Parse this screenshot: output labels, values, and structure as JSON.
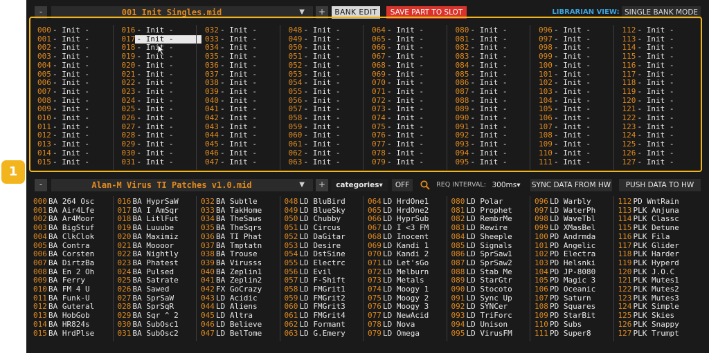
{
  "top": {
    "minus": "-",
    "file": "001 Init Singles.mid",
    "plus": "+",
    "bank_edit": "BANK EDIT",
    "save_part": "SAVE PART TO SLOT",
    "librarian_label": "LIBRARIAN VIEW:",
    "mode": "SINGLE BANK MODE"
  },
  "bottom": {
    "minus": "-",
    "file": "Alan-M Virus TI Patches v1.0.mid",
    "plus": "+",
    "categories": "categories",
    "off": "OFF",
    "req_label": "REQ INTERVAL:",
    "req_value": "300ms",
    "sync": "SYNC DATA FROM HW",
    "push": "PUSH DATA TO HW"
  },
  "bank_name": "- Init -",
  "selected_slot": "017",
  "annotation_badge": "1",
  "colors": {
    "accent": "#e08a1e",
    "highlight": "#f2b51e",
    "save": "#d9342b",
    "librarian": "#3fa3d9"
  },
  "lib_patches": [
    "BA 264 Osc",
    "BA Air4Lfe",
    "BA Ar4Moor",
    "BA BigStuf",
    "BA ClkClok",
    "BA Contra",
    "BA Corsten",
    "BA DirtzBa",
    "BA En 2 Oh",
    "BA Ferry",
    "BA FM 4 U",
    "BA Funk-U",
    "BA Guteral",
    "BA HobGob",
    "BA HR824s",
    "BA HrdPlse",
    "BA HyprSaW",
    "BA I AmSqr",
    "BA LitlFut",
    "BA Luuube",
    "BA Maximiz",
    "BA Moooor",
    "BA Nightly",
    "BA Phatest",
    "BA Pulsed",
    "BA Satrate",
    "BA Sawed",
    "BA SprSaW",
    "BA SprSqR",
    "BA Sqr ^ 2",
    "BA SubOsc1",
    "BA SubOsc2",
    "BA Subtle",
    "BA TakHome",
    "BA TheSaws",
    "BA TheSqrs",
    "BA TI Phat",
    "BA Tmptatn",
    "BA Trouse",
    "BA Virusss",
    "BA Zeplin1",
    "BA Zeplin2",
    "FX GoCrazy",
    "LD Acidic",
    "LD Aliens",
    "LD Altra",
    "LD Believe",
    "LD BelTome",
    "LD BluBird",
    "LD BlueSky",
    "LD Chubby",
    "LD Circus",
    "LD DaGitar",
    "LD Desire",
    "LD DstSine",
    "LD Electrc",
    "LD Evil",
    "LD F-Shift",
    "LD FMGrit1",
    "LD FMGrit2",
    "LD FMGrit3",
    "LD FMGrit4",
    "LD Formant",
    "LD G.Emery",
    "LD HrdOne1",
    "LD HrdOne2",
    "LD HyprSub",
    "LD I <3 FM",
    "LD Inocent",
    "LD Kandi 1",
    "LD Kandi 2",
    "LD Let'sGo",
    "LD Melburn",
    "LD Metals",
    "LD Moogy 1",
    "LD Moogy 2",
    "LD Moogy 3",
    "LD NewAcid",
    "LD Nova",
    "LD Omega",
    "LD Polar",
    "LD Prophet",
    "LD RembrMe",
    "LD Rewire",
    "LD Sheeple",
    "LD Signals",
    "LD SprSaw1",
    "LD SprSaw2",
    "LD Stab Me",
    "LD StarGtr",
    "LD Stocoto",
    "LD Sync Up",
    "LD SYNCer",
    "LD TriForc",
    "LD Unison",
    "LD VirusFM",
    "LD Warbly",
    "LD WaterPh",
    "LD WaveTbl",
    "LD XMasBel",
    "PD Andrmda",
    "PD Angelic",
    "PD Electra",
    "PD Helsnki",
    "PD JP-8080",
    "PD Magic 3",
    "PD Oceanic",
    "PD Saturn",
    "PD Squares",
    "PD StarBit",
    "PD Subs",
    "PD Super8",
    "PD WntRain",
    "PLK Anjuna",
    "PLK Classc",
    "PLK Detune",
    "PLK Fila",
    "PLK Glider",
    "PLK Harder",
    "PLK Hyperd",
    "PLK J.O.C",
    "PLK Mutes1",
    "PLK Mutes2",
    "PLK Mutes3",
    "PLK Simple",
    "PLK Skies",
    "PLK Snappy",
    "PLK Trumpt"
  ]
}
